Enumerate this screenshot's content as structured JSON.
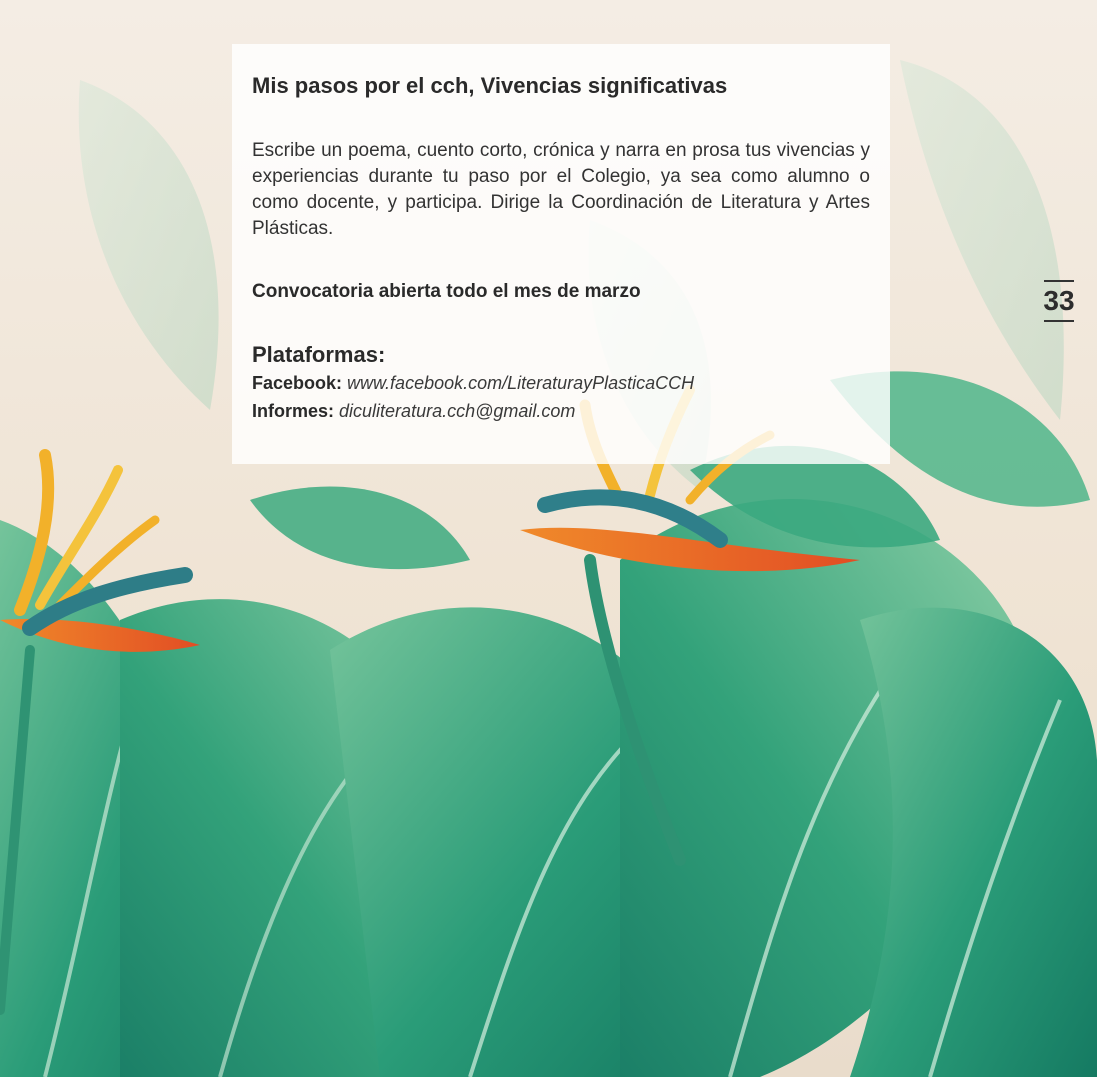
{
  "article": {
    "title": "Mis pasos por el cch, Vivencias significativas",
    "body": "Escribe un poema, cuento corto, crónica y narra en prosa tus vivencias y experiencias durante tu paso por el Colegio, ya sea como alumno o como docente, y participa. Dirige la Coordinación de Literatura y Artes Plásticas.",
    "open_call": "Convocatoria abierta todo el mes de marzo",
    "platforms_title": "Plataformas:",
    "facebook_label": "Facebook:",
    "facebook_value": "www.facebook.com/LiteraturayPlasticaCCH",
    "informes_label": "Informes:",
    "informes_value": "diculiteratura.cch@gmail.com"
  },
  "page_number": "33",
  "colors": {
    "leaf_dark": "#1f8a6a",
    "leaf_mid": "#2ea37a",
    "leaf_light": "#7cc59e",
    "flower_orange": "#e85a2a",
    "flower_yellow": "#f2b12a",
    "card_bg": "rgba(255,255,255,0.82)"
  }
}
